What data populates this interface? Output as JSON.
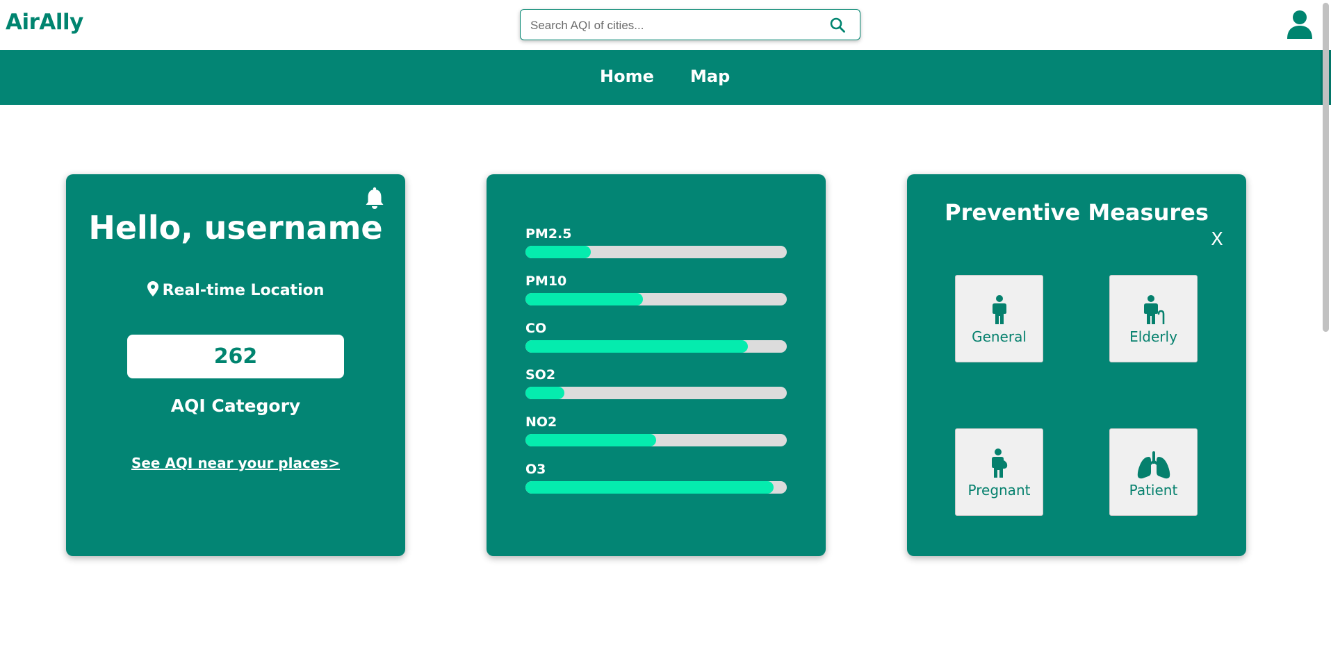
{
  "brand": {
    "name": "AirAlly"
  },
  "search": {
    "placeholder": "Search AQI of cities...",
    "value": ""
  },
  "nav": {
    "items": [
      "Home",
      "Map"
    ]
  },
  "greeting_card": {
    "greeting": "Hello, username",
    "location_label": "Real-time Location",
    "aqi_value": "262",
    "aqi_category_label": "AQI Category",
    "near_link": "See AQI near your places>"
  },
  "pollutants_card": {
    "items": [
      {
        "label": "PM2.5",
        "level": 0.25
      },
      {
        "label": "PM10",
        "level": 0.45
      },
      {
        "label": "CO",
        "level": 0.85
      },
      {
        "label": "SO2",
        "level": 0.15
      },
      {
        "label": "NO2",
        "level": 0.5
      },
      {
        "label": "O3",
        "level": 0.95
      }
    ]
  },
  "preventive_card": {
    "title": "Preventive Measures",
    "close_label": "X",
    "groups": [
      "General",
      "Elderly",
      "Pregnant",
      "Patient"
    ]
  },
  "icons": {
    "search": "search-icon",
    "user": "user-icon",
    "bell": "bell-icon",
    "location": "location-pin-icon",
    "general": "person-icon",
    "elderly": "elderly-person-icon",
    "pregnant": "pregnant-person-icon",
    "patient": "lungs-icon"
  },
  "colors": {
    "brand": "#00846f",
    "nav_bg": "#038574",
    "card_bg": "#038574",
    "bar_fill": "#05ecae",
    "bar_track": "#dcdcdc",
    "tile_bg": "#f0f0f0"
  }
}
